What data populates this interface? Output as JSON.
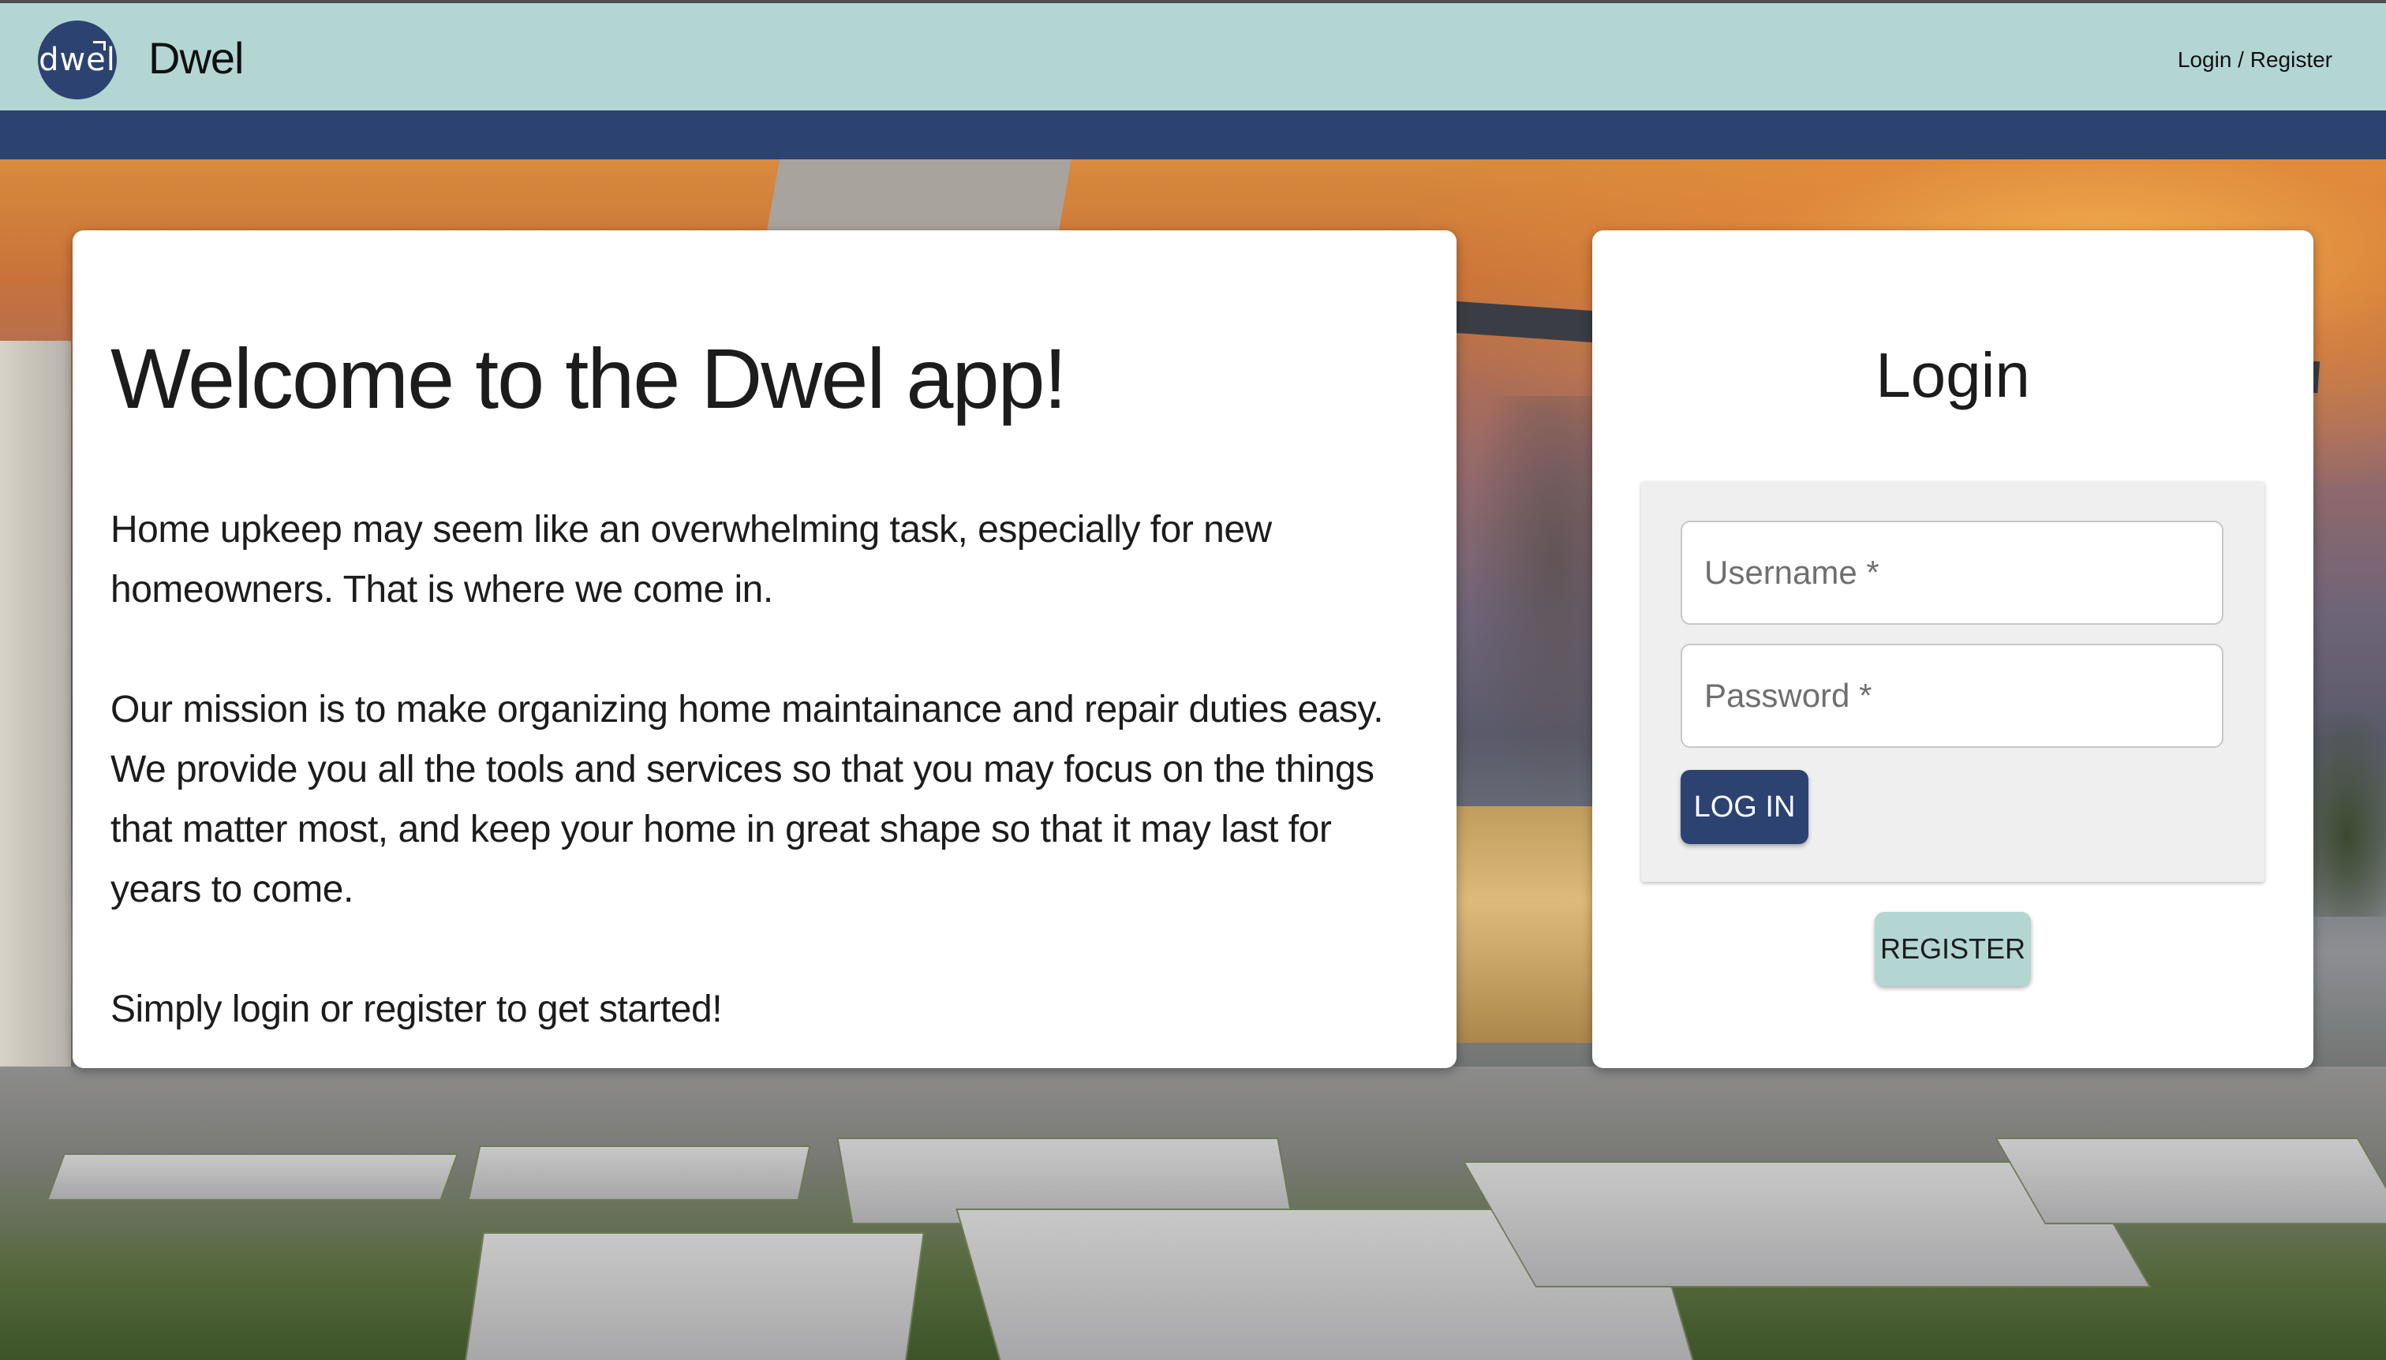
{
  "header": {
    "logo_text": "dwel",
    "app_name": "Dwel",
    "nav_link": "Login / Register"
  },
  "welcome": {
    "title": "Welcome to the Dwel app!",
    "paragraphs": [
      "Home upkeep may seem like an overwhelming task, especially for new homeowners. That is where we come in.",
      "Our mission is to make organizing home maintainance and repair duties easy. We provide you all the tools and services so that you may focus on the things that matter most, and keep your home in great shape so that it may last for years to come.",
      "Simply login or register to get started!"
    ]
  },
  "login": {
    "title": "Login",
    "username_placeholder": "Username *",
    "password_placeholder": "Password *",
    "login_button": "LOG IN",
    "register_button": "REGISTER"
  },
  "colors": {
    "header_bg": "#b3d6d3",
    "brand_navy": "#2c4371",
    "card_bg": "#ffffff",
    "form_panel_bg": "#efefef"
  },
  "icons": {
    "logo": "dwel-house-logo-icon"
  }
}
